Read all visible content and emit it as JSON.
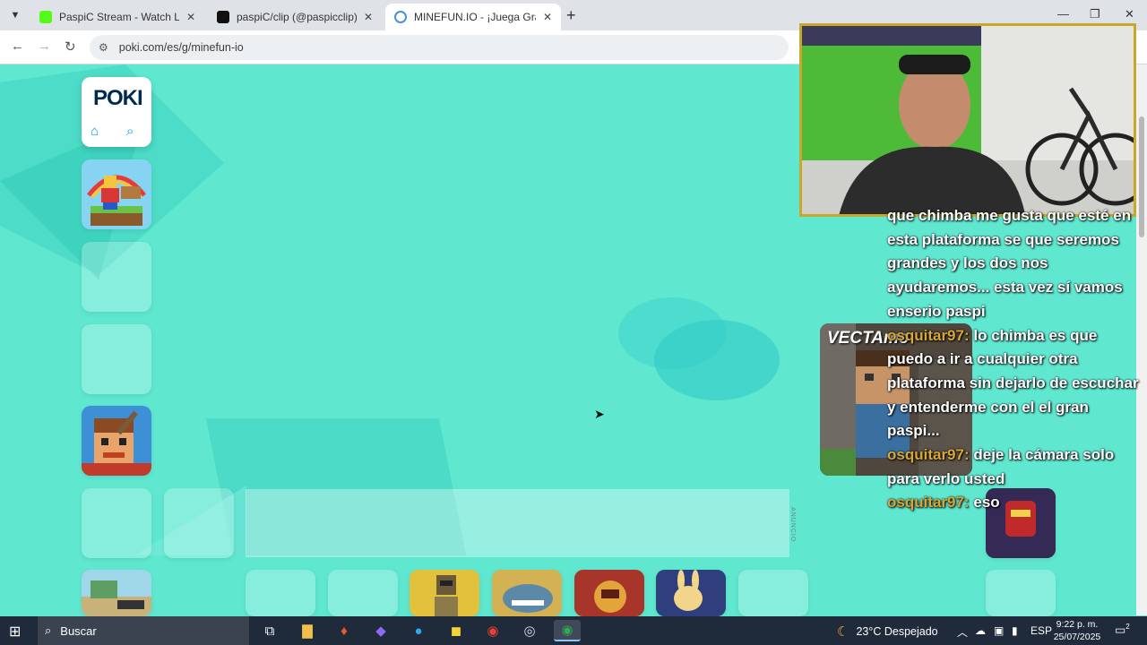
{
  "browser": {
    "tabs": [
      {
        "label": "PaspiC Stream - Watch Live on",
        "favicon_color": "#53fc18",
        "active": false
      },
      {
        "label": "paspiC/clip (@paspicclip) | TikT",
        "favicon_color": "#111111",
        "active": false
      },
      {
        "label": "MINEFUN.IO - ¡Juega Gratis Onl",
        "favicon_color": "#4a90d9",
        "active": true
      }
    ],
    "new_tab_icon": "+",
    "url": "poki.com/es/g/minefun-io"
  },
  "page": {
    "logo": "POKI",
    "home_icon": "home-icon",
    "search_icon": "search-icon",
    "ad_label": "ANUNCIO",
    "game_card_title": "VECTAmo"
  },
  "stream_chat": [
    {
      "user": "",
      "text": "que chimba me gusta que esté en esta plataforma se que seremos grandes y los dos nos ayudaremos... esta vez sí vamos enserio paspi"
    },
    {
      "user": "osquitar97:",
      "text": "lo chimba es que puedo a ir a cualquier otra plataforma sin dejarlo de escuchar y entenderme con el el gran paspi..."
    },
    {
      "user": "osquitar97:",
      "text": "deje la cámara solo para verlo usted"
    },
    {
      "user": "osquitar97:",
      "text": "eso"
    }
  ],
  "taskbar": {
    "search_placeholder": "Buscar",
    "weather": "23°C Despejado",
    "language": "ESP",
    "time": "9:22 p. m.",
    "date": "25/07/2025",
    "notifications": "2"
  },
  "colors": {
    "page_bg": "#5fe7d0",
    "chat_user": "#d9a733",
    "cam_border": "#c9a72a"
  }
}
